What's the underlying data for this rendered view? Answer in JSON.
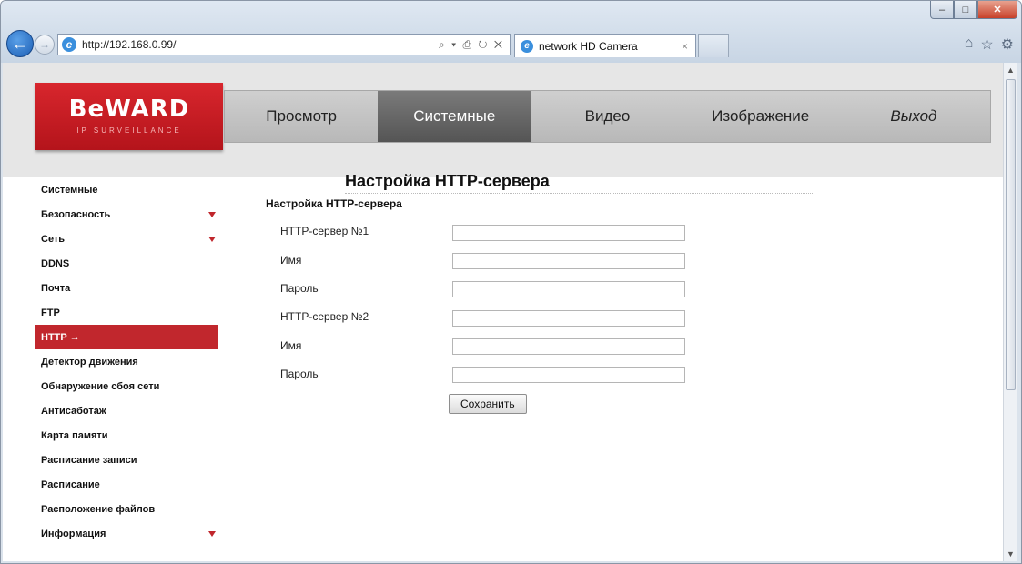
{
  "browser": {
    "url": "http://192.168.0.99/",
    "address_tools": "⌕ ▾ ⎙ ↻ ✕",
    "tab_title": "network HD Camera",
    "tab_close": "×",
    "win_controls": {
      "minimize": "–",
      "maximize": "□",
      "close": "✕"
    },
    "right_icons": {
      "home": "⌂",
      "favorites": "☆",
      "tools": "⚙"
    }
  },
  "logo": {
    "brand": "BeWARD",
    "sub": "IP SURVEILLANCE"
  },
  "topnav": [
    {
      "label": "Просмотр"
    },
    {
      "label": "Системные"
    },
    {
      "label": "Видео"
    },
    {
      "label": "Изображение"
    },
    {
      "label": "Выход"
    }
  ],
  "sidebar": [
    {
      "label": "Системные"
    },
    {
      "label": "Безопасность"
    },
    {
      "label": "Сеть"
    },
    {
      "label": "DDNS"
    },
    {
      "label": "Почта"
    },
    {
      "label": "FTP"
    },
    {
      "label": "HTTP →"
    },
    {
      "label": "Детектор движения"
    },
    {
      "label": "Обнаружение сбоя сети"
    },
    {
      "label": "Антисаботаж"
    },
    {
      "label": "Карта памяти"
    },
    {
      "label": "Расписание записи"
    },
    {
      "label": "Расписание"
    },
    {
      "label": "Расположение файлов"
    },
    {
      "label": "Информация"
    }
  ],
  "main": {
    "title": "Настройка HTTP-сервера",
    "section": "Настройка HTTP-сервера",
    "fields": [
      {
        "label": "HTTP-сервер №1",
        "value": ""
      },
      {
        "label": "Имя",
        "value": ""
      },
      {
        "label": "Пароль",
        "value": ""
      },
      {
        "label": "HTTP-сервер №2",
        "value": ""
      },
      {
        "label": "Имя",
        "value": ""
      },
      {
        "label": "Пароль",
        "value": ""
      }
    ],
    "save_label": "Сохранить"
  }
}
